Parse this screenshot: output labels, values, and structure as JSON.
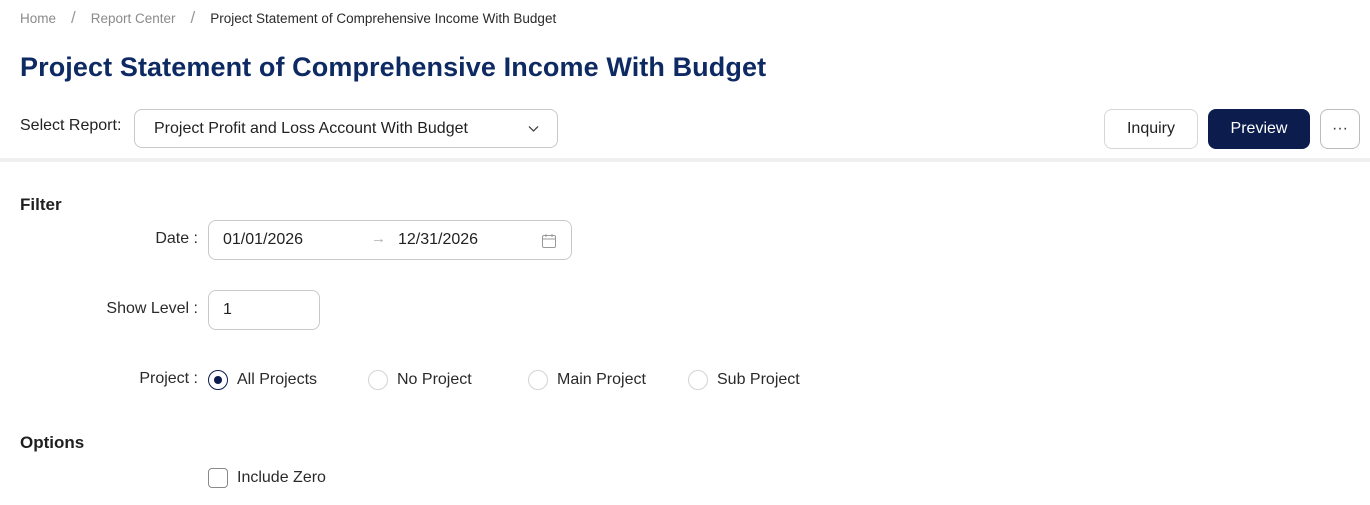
{
  "breadcrumb": {
    "home": "Home",
    "report_center": "Report Center",
    "current": "Project Statement of Comprehensive Income With Budget",
    "separator": "/"
  },
  "page_title": "Project Statement of Comprehensive Income With Budget",
  "report_selector": {
    "label": "Select Report:",
    "selected": "Project Profit and Loss Account With Budget"
  },
  "actions": {
    "inquiry": "Inquiry",
    "preview": "Preview",
    "more": "···"
  },
  "filter": {
    "title": "Filter",
    "date": {
      "label": "Date :",
      "start": "01/01/2026",
      "end": "12/31/2026",
      "arrow": "→"
    },
    "show_level": {
      "label": "Show Level :",
      "value": "1"
    },
    "project": {
      "label": "Project :",
      "selected": "All Projects",
      "options": [
        "All Projects",
        "No Project",
        "Main Project",
        "Sub Project"
      ]
    }
  },
  "options": {
    "title": "Options",
    "include_zero": {
      "label": "Include Zero",
      "checked": false
    }
  },
  "colors": {
    "title": "#0e2a63",
    "primary_button": "#0b1c4d",
    "border": "#c9c9c9"
  }
}
